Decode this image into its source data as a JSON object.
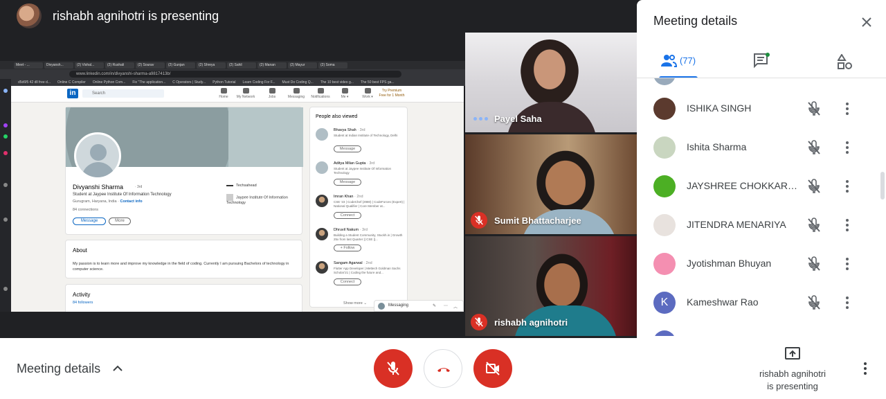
{
  "presenter": {
    "title": "rishabh agnihotri is presenting"
  },
  "shared_screen": {
    "tabs": [
      "Meet - ...",
      "Divyansh...",
      "(2) Vishal...",
      "(2) Rushali",
      "(2) Sourav",
      "(2) Gunjan",
      "(2) Shreya",
      "(2) Sahil",
      "(2) Manan",
      "(2) Mayur",
      "(2) Soma"
    ],
    "url": "www.linkedin.com/in/divyanshi-sharma-a9817413b/",
    "bookmarks": [
      "d5d6f5 42 dll free d...",
      "Online C Compiler",
      "Online Python Com...",
      "Fix \"The application...",
      "C Operators | Study...",
      "Python Tutorial",
      "Learn Coding For F...",
      "Must Do Coding Q...",
      "The 10 best video g...",
      "The 50 best FPS ga..."
    ],
    "linkedin": {
      "search_placeholder": "Search",
      "nav": [
        "Home",
        "My Network",
        "Jobs",
        "Messaging",
        "Notifications",
        "Me ▾",
        "Work ▾"
      ],
      "premium": "Try Premium Free for 1 Month",
      "profile": {
        "name": "Divyanshi Sharma",
        "degree": "· 3rd",
        "headline": "Student at Jaypee Institute Of Information Technology",
        "location": "Gurugram, Haryana, India ·",
        "contact": "Contact info",
        "connections": "84 connections",
        "message_btn": "Message",
        "more_btn": "More",
        "company": "Techsahead",
        "school": "Jaypee Institute Of Information Technology"
      },
      "about": {
        "title": "About",
        "text": "My passion is to learn more and improve my knowledge in the field of coding. Currently I am pursuing Bachelors of technology in computer science."
      },
      "activity": {
        "title": "Activity",
        "followers": "84 followers"
      },
      "people_also_viewed": {
        "title": "People also viewed",
        "items": [
          {
            "name": "Bhavya Shah",
            "degree": "· 3rd",
            "desc": "Student at Indian Institute of Technology, Delhi",
            "btn": "Message"
          },
          {
            "name": "Aditya Milan Gupta",
            "degree": "· 3rd",
            "desc": "Student at Jaypee Institute Of Information Technology",
            "btn": "Message"
          },
          {
            "name": "Imran Khan",
            "degree": "· 2nd",
            "desc": "CSE '23 | CodeChef (2980) | CodeForces (Expert) | National Qualifier | Core Member at...",
            "btn": "Connect"
          },
          {
            "name": "Dhruvil Nakum",
            "degree": "· 3rd",
            "desc": "Building a Student Community, Stuckh.in | Growth 25x from last Quarter || CSE ||...",
            "btn": "+ Follow"
          },
          {
            "name": "Sangam Agarwal",
            "degree": "· 2nd",
            "desc": "Flutter App Developer | Mettech Goldman Sachs Scholar'21 | Coding the future and...",
            "btn": "Connect"
          }
        ],
        "show_more": "Show more ⌄"
      },
      "messaging": "Messaging"
    }
  },
  "participants_tiles": [
    {
      "name": "Payel Saha",
      "muted": false
    },
    {
      "name": "Sumit Bhattacharjee",
      "muted": true
    },
    {
      "name": "rishabh agnihotri",
      "muted": true
    }
  ],
  "panel": {
    "title": "Meeting details",
    "people_count": "(77)",
    "people": [
      {
        "name": "ISHIKA SINGH",
        "initial": "",
        "avatar_color": "#5b3a2e"
      },
      {
        "name": "Ishita Sharma",
        "initial": "",
        "avatar_color": "#c9d6c0"
      },
      {
        "name": "JAYSHREE CHOKKARA...",
        "initial": "",
        "avatar_color": "#4caf24"
      },
      {
        "name": "JITENDRA MENARIYA",
        "initial": "",
        "avatar_color": "#e8e2de"
      },
      {
        "name": "Jyotishman Bhuyan",
        "initial": "",
        "avatar_color": "#f48fb1"
      },
      {
        "name": "Kameshwar Rao",
        "initial": "K",
        "avatar_color": "#5c6bc0"
      }
    ]
  },
  "bottom": {
    "meeting_details": "Meeting details",
    "presenting_line1": "rishabh agnihotri",
    "presenting_line2": "is presenting"
  },
  "colors": {
    "accent": "#1a73e8",
    "danger": "#d93025"
  }
}
